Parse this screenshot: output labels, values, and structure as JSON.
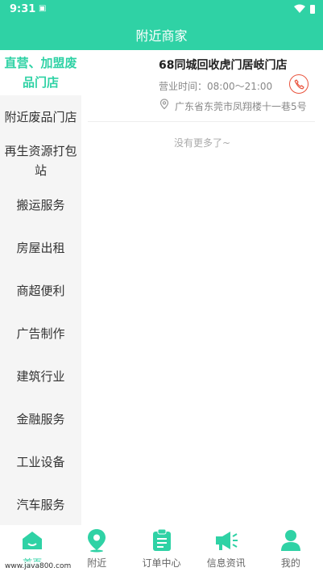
{
  "status_bar": {
    "time": "9:31",
    "sim_label": "SIM"
  },
  "header": {
    "title": "附近商家"
  },
  "sidebar": {
    "items": [
      {
        "label": "直营、加盟废品门店",
        "active": true
      },
      {
        "label": "附近废品门店"
      },
      {
        "label": "再生资源打包站"
      },
      {
        "label": "搬运服务"
      },
      {
        "label": "房屋出租"
      },
      {
        "label": "商超便利"
      },
      {
        "label": "广告制作"
      },
      {
        "label": "建筑行业"
      },
      {
        "label": "金融服务"
      },
      {
        "label": "工业设备"
      },
      {
        "label": "汽车服务"
      }
    ]
  },
  "shop": {
    "name": "68同城回收虎门居岐门店",
    "hours": "营业时间：08:00～21:00",
    "address": "广东省东莞市凤翔楼十一巷5号"
  },
  "list": {
    "no_more": "没有更多了~"
  },
  "tabbar": {
    "tabs": [
      {
        "label": "首页",
        "icon": "home-icon",
        "active": true
      },
      {
        "label": "附近",
        "icon": "location-icon"
      },
      {
        "label": "订单中心",
        "icon": "clipboard-icon"
      },
      {
        "label": "信息资讯",
        "icon": "megaphone-icon"
      },
      {
        "label": "我的",
        "icon": "user-icon"
      }
    ]
  },
  "watermark": "www.java800.com",
  "colors": {
    "accent": "#2fd2a5",
    "phone": "#e9533d"
  }
}
